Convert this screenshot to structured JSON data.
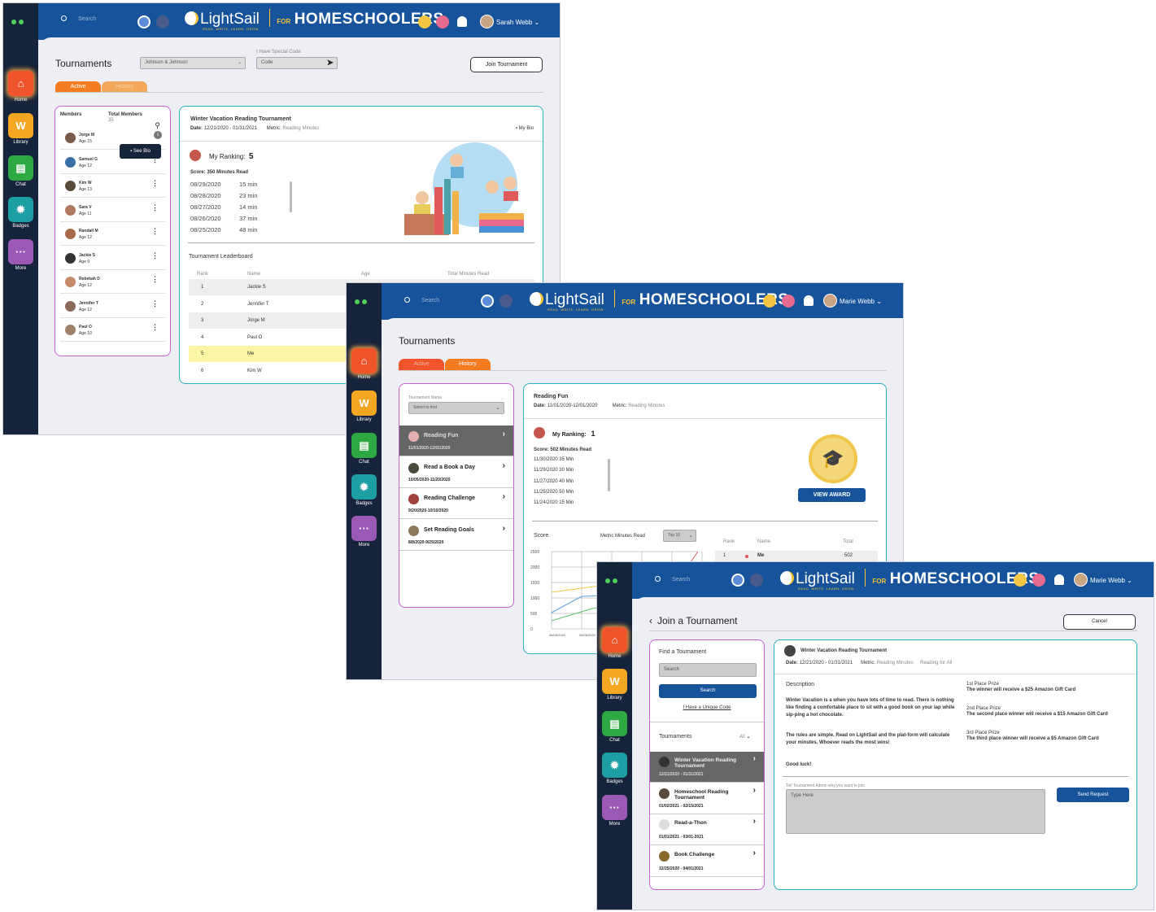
{
  "colors": {
    "nav_bg": "#15243a",
    "topbar": "#16539b",
    "home": "#f0542a",
    "library": "#f5a623",
    "chat": "#2ea843",
    "badges": "#1c9ea3",
    "more": "#9b59b6",
    "accent_orange": "#f47b20",
    "purple_border": "#c860d0",
    "teal_border": "#29b0b9"
  },
  "brand": {
    "name": "LightSail",
    "tagline": "READ. WRITE. LEARN. GROW.",
    "for": "FOR",
    "product": "HOMESCHOOLERS"
  },
  "nav": [
    {
      "label": "Home",
      "icon": "home-icon"
    },
    {
      "label": "Library",
      "icon": "library-icon",
      "glyph": "W"
    },
    {
      "label": "Library",
      "icon": "library-icon"
    },
    {
      "label": "Chat",
      "icon": "chat-icon"
    },
    {
      "label": "Badges",
      "icon": "badge-icon"
    },
    {
      "label": "More",
      "icon": "more-icon",
      "glyph": "···"
    }
  ],
  "screen1": {
    "search": "Search",
    "user": "Sarah Webb ⌄",
    "title": "Tournaments",
    "select_value": "Johnson & Johnson",
    "code_label": "I Have Special Code",
    "code_placeholder": "Code",
    "join_button": "Join Tournament",
    "tabs": {
      "active": "Active",
      "history": "History"
    },
    "members_header": "Members",
    "total_members_label": "Total Members",
    "total_members": "35",
    "see_bio": "See Bio",
    "members": [
      {
        "name": "Jorge M",
        "age": "Age 15"
      },
      {
        "name": "Samuel G",
        "age": "Age 12"
      },
      {
        "name": "Kim W",
        "age": "Age 13"
      },
      {
        "name": "Sara V",
        "age": "Age 11"
      },
      {
        "name": "Randall M",
        "age": "Age 12"
      },
      {
        "name": "Jackie S",
        "age": "Age 9"
      },
      {
        "name": "Rebekah D",
        "age": "Age 12"
      },
      {
        "name": "Jennifer T",
        "age": "Age 12"
      },
      {
        "name": "Paul O",
        "age": "Age 10"
      }
    ],
    "tournament": {
      "name": "Winter Vacation Reading Tournament",
      "date_label": "Date:",
      "date": "12/21/2020 - 01/31/2021",
      "metric_label": "Metric:",
      "metric": "Reading Minutes",
      "my_bio": "My Bio",
      "ranking_label": "My Ranking:",
      "ranking": "5",
      "score": "Score: 350 Minutes Read",
      "log": [
        {
          "date": "08/29/2020",
          "val": "15 min"
        },
        {
          "date": "08/28/2020",
          "val": "23 min"
        },
        {
          "date": "08/27/2020",
          "val": "14 min"
        },
        {
          "date": "08/26/2020",
          "val": "37 min"
        },
        {
          "date": "08/25/2020",
          "val": "48 min"
        }
      ],
      "leaderboard_title": "Tournament Leaderboard",
      "lb_headers": {
        "rank": "Rank",
        "name": "Name",
        "age": "Age",
        "total": "Total Minutes Read"
      },
      "leaderboard": [
        {
          "rank": "1",
          "name": "Jackie S"
        },
        {
          "rank": "2",
          "name": "Jennifer T"
        },
        {
          "rank": "3",
          "name": "Jorge M"
        },
        {
          "rank": "4",
          "name": "Paul O"
        },
        {
          "rank": "5",
          "name": "Me"
        },
        {
          "rank": "6",
          "name": "Kim W"
        }
      ]
    }
  },
  "screen2": {
    "search": "Search",
    "user": "Marie Webb ⌄",
    "title": "Tournaments",
    "tabs": {
      "active": "Active",
      "history": "History"
    },
    "filter_label": "Tournament Name",
    "filter_placeholder": "Select to find",
    "list": [
      {
        "name": "Reading Fun",
        "dates": "11/01/2020-12/01/2020"
      },
      {
        "name": "Read a Book a Day",
        "dates": "10/05/2020-11/20/2020"
      },
      {
        "name": "Reading Challenge",
        "dates": "9/20/2020-10/10/2020"
      },
      {
        "name": "Set Reading Goals",
        "dates": "8/8/2020-9/25/2020"
      }
    ],
    "detail": {
      "name": "Reading Fun",
      "date_label": "Date:",
      "date": "11/01/2020-12/01/2020",
      "metric_label": "Metric:",
      "metric": "Reading Minutes",
      "ranking_label": "My Ranking:",
      "ranking": "1",
      "score": "Score: 502 Minutes Read",
      "log": [
        "11/30/2020 35 Min",
        "11/29/2020 30 Min",
        "11/27/2020 40 Min",
        "11/25/2020 50 Min",
        "11/24/2020 15 Min"
      ],
      "view_award": "VIEW AWARD",
      "score_label": "Score",
      "metric_text": "Metric Minutes Read",
      "top_select": "Top 10",
      "lb_headers": {
        "rank": "Rank",
        "name": "Name",
        "total": "Total"
      },
      "lb_row": {
        "rank": "1",
        "name": "Me",
        "total": "502"
      },
      "chart_y": [
        "2500",
        "2000",
        "1500",
        "1000",
        "500",
        "0"
      ],
      "chart_x": [
        "08/25/2020",
        "08/26/2020"
      ]
    }
  },
  "screen3": {
    "search": "Search",
    "user": "Marie Webb ⌄",
    "title": "Join a Tournament",
    "cancel": "Cancel",
    "find_title": "Find a Tournament",
    "search_placeholder": "Search",
    "search_button": "Search",
    "unique_code": "I Have a Unique Code",
    "tournaments_label": "Tournaments",
    "filter": "All",
    "list": [
      {
        "name": "Winter Vacation Reading Tournament",
        "dates": "12/21/2020 - 01/31/2021"
      },
      {
        "name": "Homeschool Reading Tournament",
        "dates": "01/02/2021 - 02/15/2021"
      },
      {
        "name": "Read-a-Thon",
        "dates": "01/01/2021 - 03/01-2021"
      },
      {
        "name": "Book Challenge",
        "dates": "12/25/2020 - 04/01/2021"
      }
    ],
    "detail": {
      "name": "Winter Vacation Reading Tournament",
      "date_label": "Date:",
      "date": "12/21/2020 - 01/31/2021",
      "metric_label": "Metric:",
      "metric": "Reading Minutes",
      "audience": "Reading for All",
      "desc_title": "Description",
      "desc1": "Winter Vacation is a when you have lots of time to read. There is nothing like finding a comfortable place to sit with a good book on your lap while sip-ping a hot chocolate.",
      "desc2": "The rules are simple. Read on LightSail and the plat-form will calculate your minutes. Whoever reads the most wins!",
      "desc3": "Good luck!",
      "prizes": [
        {
          "title": "1st Place Prize",
          "text": "The winner will receive a $25 Amazon Gift Card"
        },
        {
          "title": "2nd Place Prize",
          "text": "The second place winner will receive a $15 Amazon Gift Card"
        },
        {
          "title": "3rd Place Prize",
          "text": "The third place winner will receive a $5 Amazon Gift Card"
        }
      ],
      "admin_label": "Tell Tournament Admin why you want to join",
      "admin_placeholder": "Type Here",
      "send": "Send Request"
    }
  }
}
